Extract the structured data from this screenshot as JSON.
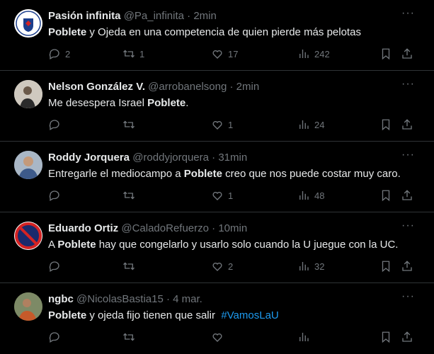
{
  "tweets": [
    {
      "name": "Pasión infinita",
      "handle": "@Pa_infinita",
      "time": "2min",
      "text_before": "",
      "bold": "Poblete",
      "text_after": " y Ojeda en una competencia de quien pierde más pelotas",
      "hashtag": "",
      "replies": "2",
      "retweets": "1",
      "likes": "17",
      "views": "242",
      "avatar_color": "#ffffff"
    },
    {
      "name": "Nelson González V.",
      "handle": "@arrobanelsong",
      "time": "2min",
      "text_before": "Me desespera Israel ",
      "bold": "Poblete",
      "text_after": ".",
      "hashtag": "",
      "replies": "",
      "retweets": "",
      "likes": "1",
      "views": "24",
      "avatar_color": "#d8d2c8"
    },
    {
      "name": "Roddy Jorquera",
      "handle": "@roddyjorquera",
      "time": "31min",
      "text_before": "Entregarle el mediocampo a ",
      "bold": "Poblete",
      "text_after": " creo que nos puede costar muy caro.",
      "hashtag": "",
      "replies": "",
      "retweets": "",
      "likes": "1",
      "views": "48",
      "avatar_color": "#8a9bb0"
    },
    {
      "name": "Eduardo Ortiz",
      "handle": "@CaladoRefuerzo",
      "time": "10min",
      "text_before": "A ",
      "bold": "Poblete",
      "text_after": " hay que congelarlo y usarlo solo cuando la U juegue con la UC.",
      "hashtag": "",
      "replies": "",
      "retweets": "",
      "likes": "2",
      "views": "32",
      "avatar_color": "#d42323"
    },
    {
      "name": "ngbc",
      "handle": "@NicolasBastia15",
      "time": "4 mar.",
      "text_before": "",
      "bold": "Poblete",
      "text_after": " y ojeda fijo tienen que salir  ",
      "hashtag": "#VamosLaU",
      "replies": "",
      "retweets": "",
      "likes": "",
      "views": "",
      "avatar_color": "#6b7a55"
    }
  ],
  "colors": {
    "background": "#000000",
    "text": "#e7e9ea",
    "muted": "#71767b",
    "link": "#1d9bf0",
    "divider": "#2f3336"
  },
  "icons": [
    "reply-icon",
    "retweet-icon",
    "like-icon",
    "views-icon",
    "bookmark-icon",
    "share-icon",
    "more-icon"
  ]
}
